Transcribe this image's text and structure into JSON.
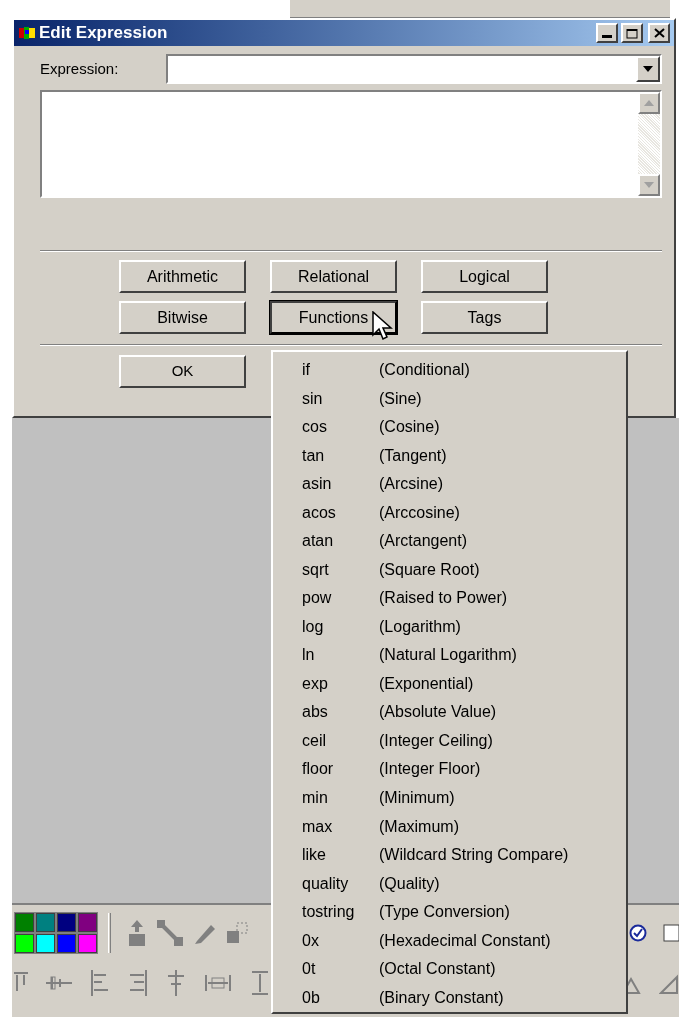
{
  "window": {
    "title": "Edit Expression"
  },
  "expression": {
    "label": "Expression:"
  },
  "operator_buttons": [
    {
      "label": "Arithmetic",
      "focused": false
    },
    {
      "label": "Relational",
      "focused": false
    },
    {
      "label": "Logical",
      "focused": false
    },
    {
      "label": "Bitwise",
      "focused": false
    },
    {
      "label": "Functions",
      "focused": true
    },
    {
      "label": "Tags",
      "focused": false
    }
  ],
  "ok_button": "OK",
  "functions_menu": [
    {
      "name": "if",
      "description": "(Conditional)"
    },
    {
      "name": "sin",
      "description": "(Sine)"
    },
    {
      "name": "cos",
      "description": "(Cosine)"
    },
    {
      "name": "tan",
      "description": "(Tangent)"
    },
    {
      "name": "asin",
      "description": "(Arcsine)"
    },
    {
      "name": "acos",
      "description": "(Arccosine)"
    },
    {
      "name": "atan",
      "description": "(Arctangent)"
    },
    {
      "name": "sqrt",
      "description": "(Square Root)"
    },
    {
      "name": "pow",
      "description": "(Raised to Power)"
    },
    {
      "name": "log",
      "description": "(Logarithm)"
    },
    {
      "name": "ln",
      "description": "(Natural Logarithm)"
    },
    {
      "name": "exp",
      "description": "(Exponential)"
    },
    {
      "name": "abs",
      "description": "(Absolute Value)"
    },
    {
      "name": "ceil",
      "description": "(Integer Ceiling)"
    },
    {
      "name": "floor",
      "description": "(Integer Floor)"
    },
    {
      "name": "min",
      "description": "(Minimum)"
    },
    {
      "name": "max",
      "description": "(Maximum)"
    },
    {
      "name": "like",
      "description": "(Wildcard String Compare)"
    },
    {
      "name": "quality",
      "description": "(Quality)"
    },
    {
      "name": "tostring",
      "description": "(Type Conversion)"
    },
    {
      "name": "0x",
      "description": "(Hexadecimal Constant)"
    },
    {
      "name": "0t",
      "description": "(Octal Constant)"
    },
    {
      "name": "0b",
      "description": "(Binary Constant)"
    }
  ],
  "palette": [
    {
      "color": "#008000"
    },
    {
      "color": "#008080"
    },
    {
      "color": "#000080"
    },
    {
      "color": "#800080"
    },
    {
      "color": "#00ff00"
    },
    {
      "color": "#00ffff"
    },
    {
      "color": "#0000ff"
    },
    {
      "color": "#ff00ff"
    }
  ]
}
